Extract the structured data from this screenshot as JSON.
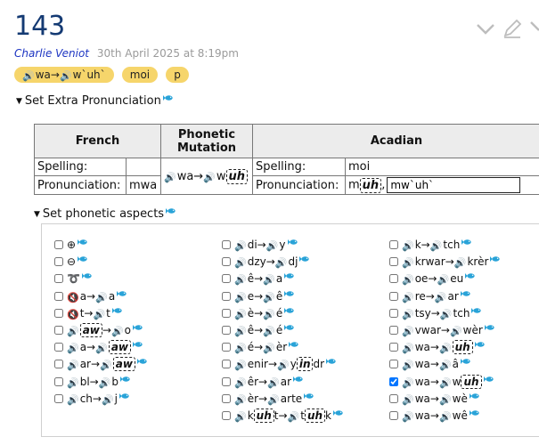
{
  "header": {
    "title": "143",
    "author": "Charlie Veniot",
    "date": "30th April 2025 at 8:19pm"
  },
  "tags": [
    {
      "parts": [
        {
          "t": "spk"
        },
        {
          "t": "wa→"
        },
        {
          "t": "spk"
        },
        {
          "t": "w`uh`"
        }
      ]
    },
    {
      "parts": [
        {
          "t": "moi"
        }
      ]
    },
    {
      "parts": [
        {
          "t": "p"
        }
      ]
    }
  ],
  "extra_section": {
    "label": "Set Extra Pronunciation"
  },
  "pron_table": {
    "french_header": "French",
    "mutation_header": "Phonetic Mutation",
    "acadian_header": "Acadian",
    "spelling_label": "Spelling:",
    "pronunciation_label": "Pronunciation:",
    "french_spelling": "",
    "french_pronunciation": "mwa",
    "acadian_spelling": "moi",
    "mutation_parts": [
      {
        "t": "spk"
      },
      {
        "t": "wa→"
      },
      {
        "t": "spk"
      },
      {
        "t": "w"
      },
      {
        "t": "uh",
        "d": true
      }
    ],
    "acadian_pron_parts": [
      {
        "t": "m"
      },
      {
        "t": "uh",
        "d": true
      },
      {
        "t": ","
      }
    ],
    "acadian_pron_input": "mw`uh`"
  },
  "aspects_section": {
    "label": "Set phonetic aspects",
    "columns": [
      [
        {
          "checked": false,
          "parts": [
            {
              "t": "⊕"
            }
          ]
        },
        {
          "checked": false,
          "parts": [
            {
              "t": "⊖"
            }
          ]
        },
        {
          "checked": false,
          "parts": [
            {
              "t": "➰"
            }
          ]
        },
        {
          "checked": false,
          "parts": [
            {
              "t": "mute"
            },
            {
              "t": "a→"
            },
            {
              "t": "spk"
            },
            {
              "t": "a"
            }
          ]
        },
        {
          "checked": false,
          "parts": [
            {
              "t": "mute"
            },
            {
              "t": "t→"
            },
            {
              "t": "spk"
            },
            {
              "t": "t"
            }
          ]
        },
        {
          "checked": false,
          "parts": [
            {
              "t": "spk"
            },
            {
              "t": "aw",
              "d": true
            },
            {
              "t": "→"
            },
            {
              "t": "spk"
            },
            {
              "t": "o"
            }
          ]
        },
        {
          "checked": false,
          "parts": [
            {
              "t": "spk"
            },
            {
              "t": "a→"
            },
            {
              "t": "spk"
            },
            {
              "t": "aw",
              "d": true
            }
          ]
        },
        {
          "checked": false,
          "parts": [
            {
              "t": "spk"
            },
            {
              "t": "ar→"
            },
            {
              "t": "spk"
            },
            {
              "t": "aw",
              "d": true
            }
          ]
        },
        {
          "checked": false,
          "parts": [
            {
              "t": "spk"
            },
            {
              "t": "bl→"
            },
            {
              "t": "spk"
            },
            {
              "t": "b"
            }
          ]
        },
        {
          "checked": false,
          "parts": [
            {
              "t": "spk"
            },
            {
              "t": "ch→"
            },
            {
              "t": "spk"
            },
            {
              "t": "j"
            }
          ]
        }
      ],
      [
        {
          "checked": false,
          "parts": [
            {
              "t": "spk"
            },
            {
              "t": "di→"
            },
            {
              "t": "spk"
            },
            {
              "t": "y"
            }
          ]
        },
        {
          "checked": false,
          "parts": [
            {
              "t": "spk"
            },
            {
              "t": "dzy→"
            },
            {
              "t": "spk"
            },
            {
              "t": "dj"
            }
          ]
        },
        {
          "checked": false,
          "parts": [
            {
              "t": "spk"
            },
            {
              "t": "ê→"
            },
            {
              "t": "spk"
            },
            {
              "t": "a"
            }
          ]
        },
        {
          "checked": false,
          "parts": [
            {
              "t": "spk"
            },
            {
              "t": "e→"
            },
            {
              "t": "spk"
            },
            {
              "t": "ê"
            }
          ]
        },
        {
          "checked": false,
          "parts": [
            {
              "t": "spk"
            },
            {
              "t": "è→"
            },
            {
              "t": "spk"
            },
            {
              "t": "é"
            }
          ]
        },
        {
          "checked": false,
          "parts": [
            {
              "t": "spk"
            },
            {
              "t": "ê→"
            },
            {
              "t": "spk"
            },
            {
              "t": "é"
            }
          ]
        },
        {
          "checked": false,
          "parts": [
            {
              "t": "spk"
            },
            {
              "t": "é→"
            },
            {
              "t": "spk"
            },
            {
              "t": "èr"
            }
          ]
        },
        {
          "checked": false,
          "parts": [
            {
              "t": "spk"
            },
            {
              "t": "enir→"
            },
            {
              "t": "spk"
            },
            {
              "t": "y"
            },
            {
              "t": "in",
              "d": true
            },
            {
              "t": "dr"
            }
          ]
        },
        {
          "checked": false,
          "parts": [
            {
              "t": "spk"
            },
            {
              "t": "êr→"
            },
            {
              "t": "spk"
            },
            {
              "t": "ar"
            }
          ]
        },
        {
          "checked": false,
          "parts": [
            {
              "t": "spk"
            },
            {
              "t": "èr→"
            },
            {
              "t": "spk"
            },
            {
              "t": "arte"
            }
          ]
        },
        {
          "checked": false,
          "parts": [
            {
              "t": "spk"
            },
            {
              "t": "k"
            },
            {
              "t": "uh",
              "d": true
            },
            {
              "t": "t→"
            },
            {
              "t": "spk"
            },
            {
              "t": "t"
            },
            {
              "t": "uh",
              "d": true
            },
            {
              "t": "k"
            }
          ]
        }
      ],
      [
        {
          "checked": false,
          "parts": [
            {
              "t": "spk"
            },
            {
              "t": "k→"
            },
            {
              "t": "spk"
            },
            {
              "t": "tch"
            }
          ]
        },
        {
          "checked": false,
          "parts": [
            {
              "t": "spk"
            },
            {
              "t": "krwar→"
            },
            {
              "t": "spk"
            },
            {
              "t": "krèr"
            }
          ]
        },
        {
          "checked": false,
          "parts": [
            {
              "t": "spk"
            },
            {
              "t": "oe→"
            },
            {
              "t": "spk"
            },
            {
              "t": "eu"
            }
          ]
        },
        {
          "checked": false,
          "parts": [
            {
              "t": "spk"
            },
            {
              "t": "re→"
            },
            {
              "t": "spk"
            },
            {
              "t": "ar"
            }
          ]
        },
        {
          "checked": false,
          "parts": [
            {
              "t": "spk"
            },
            {
              "t": "tsy→"
            },
            {
              "t": "spk"
            },
            {
              "t": "tch"
            }
          ]
        },
        {
          "checked": false,
          "parts": [
            {
              "t": "spk"
            },
            {
              "t": "vwar→"
            },
            {
              "t": "spk"
            },
            {
              "t": "wèr"
            }
          ]
        },
        {
          "checked": false,
          "parts": [
            {
              "t": "spk"
            },
            {
              "t": "wa→"
            },
            {
              "t": "spk"
            },
            {
              "t": "uh",
              "d": true
            }
          ]
        },
        {
          "checked": false,
          "parts": [
            {
              "t": "spk"
            },
            {
              "t": "wa→"
            },
            {
              "t": "spk"
            },
            {
              "t": "â"
            }
          ]
        },
        {
          "checked": true,
          "parts": [
            {
              "t": "spk"
            },
            {
              "t": "wa→"
            },
            {
              "t": "spk"
            },
            {
              "t": "w"
            },
            {
              "t": "uh",
              "d": true
            }
          ]
        },
        {
          "checked": false,
          "parts": [
            {
              "t": "spk"
            },
            {
              "t": "wa→"
            },
            {
              "t": "spk"
            },
            {
              "t": "wè"
            }
          ]
        },
        {
          "checked": false,
          "parts": [
            {
              "t": "spk"
            },
            {
              "t": "wa→"
            },
            {
              "t": "spk"
            },
            {
              "t": "wê"
            }
          ]
        }
      ]
    ]
  },
  "icons": {
    "speaker": "speaker-icon",
    "muted": "muted-speaker-icon",
    "fish": "fish-icon",
    "edit": "pencil-icon",
    "expand": "chevron-down-icon"
  },
  "colors": {
    "title": "#143a73",
    "author": "#1d35c2",
    "tag": "#f6d56b",
    "fish": "#29a3d8",
    "muted": "#d32f2f"
  }
}
